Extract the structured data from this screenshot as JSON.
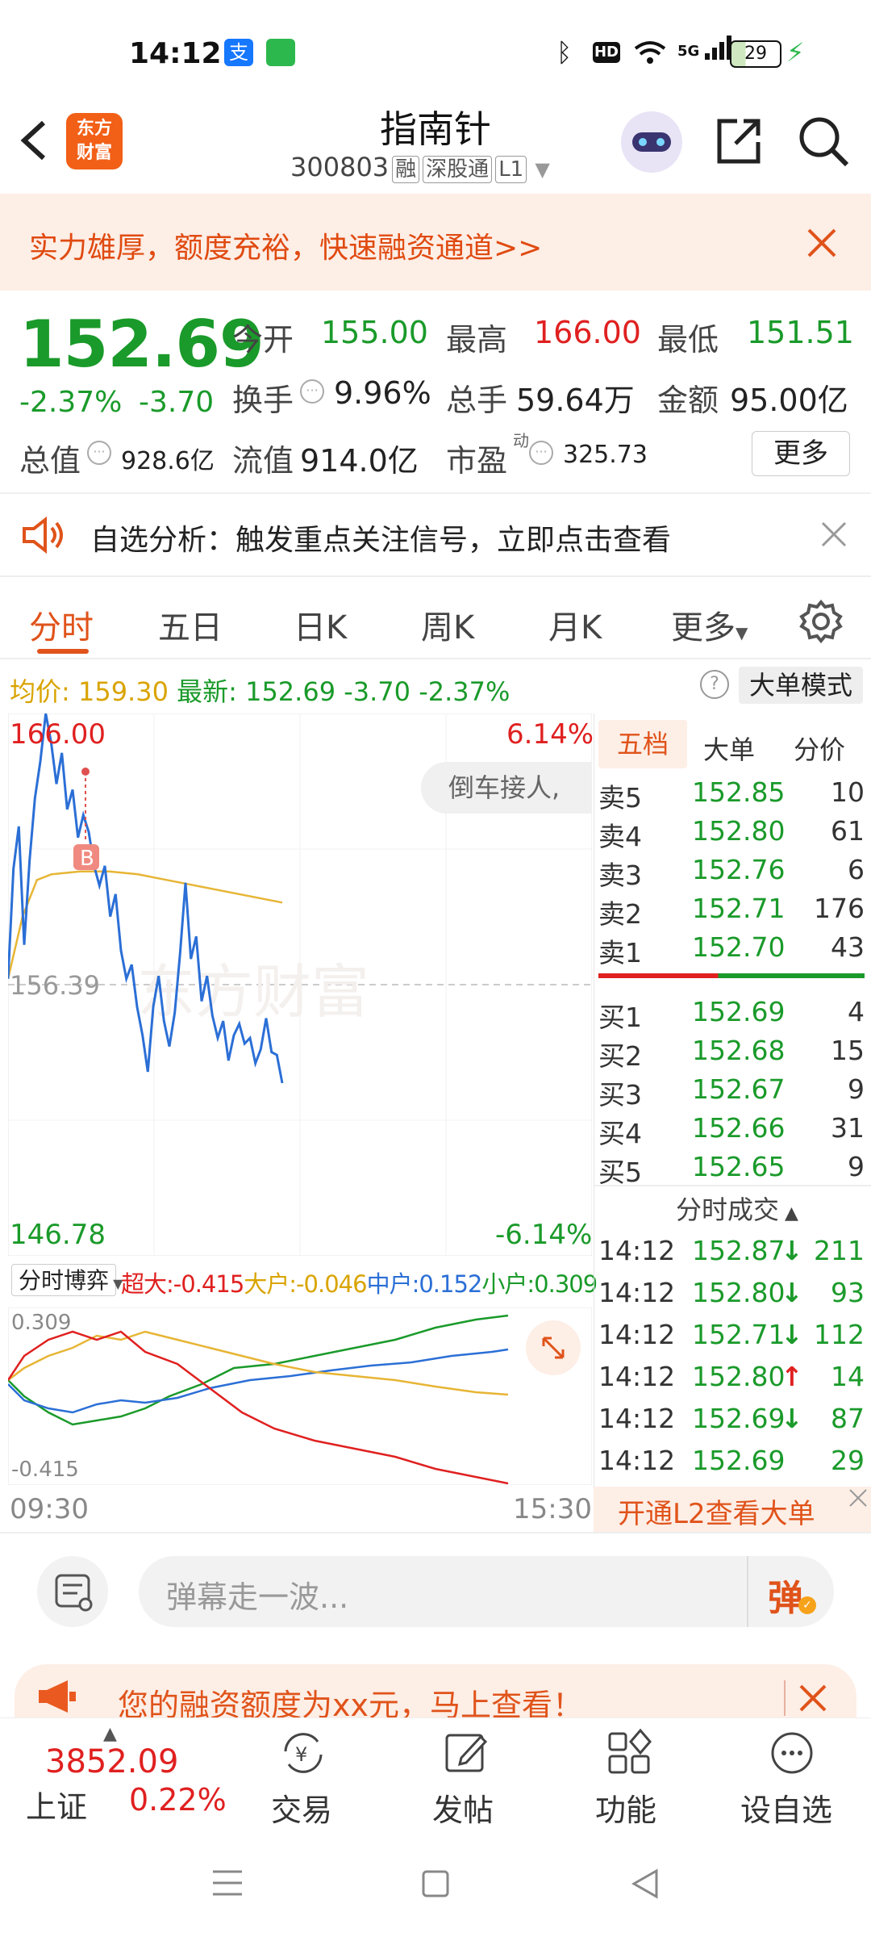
{
  "status": {
    "time": "14:12",
    "battery": "29",
    "network": "5G"
  },
  "header": {
    "back_icon": "chevron-left-icon",
    "logo_text": "东方\n财富",
    "logo_line1": "东方",
    "logo_line2": "财富",
    "name": "指南针",
    "code": "300803",
    "tags": [
      "融",
      "深股通",
      "L1"
    ]
  },
  "banner": {
    "text": "实力雄厚，额度充裕，快速融资通道>>"
  },
  "quote": {
    "price": "152.69",
    "change_pct": "-2.37%",
    "change": "-3.70",
    "open_label": "今开",
    "open": "155.00",
    "high_label": "最高",
    "high": "166.00",
    "low_label": "最低",
    "low": "151.51",
    "turnover_label": "换手",
    "turnover": "9.96%",
    "volume_label": "总手",
    "volume": "59.64万",
    "amount_label": "金额",
    "amount": "95.00亿",
    "mcap_label": "总值",
    "mcap": "928.6亿",
    "float_label": "流值",
    "float": "914.0亿",
    "pe_label": "市盈",
    "pe_sup": "动",
    "pe": "325.73",
    "more_button": "更多"
  },
  "analysis": {
    "text": "自选分析：触发重点关注信号，立即点击查看"
  },
  "tabs": [
    "分时",
    "五日",
    "日K",
    "周K",
    "月K",
    "更多"
  ],
  "avgbar": {
    "avg_label": "均价:",
    "avg": "159.30",
    "latest_label": "最新:",
    "latest": "152.69",
    "change": "-3.70",
    "change_pct": "-2.37%",
    "mode_button": "大单模式"
  },
  "chart": {
    "high": "166.00",
    "high_pct": "6.14%",
    "low": "146.78",
    "low_pct": "-6.14%",
    "mid": "156.39",
    "marker": "B",
    "danmu": "倒车接人,",
    "watermark": "东方财富",
    "time_start": "09:30",
    "time_end": "15:30",
    "colors": {
      "price": "#2b6fd6",
      "avg": "#e7b535",
      "up": "#e02020",
      "down": "#1a9a2a"
    }
  },
  "chart_data": {
    "type": "line",
    "series": [
      {
        "name": "",
        "values": [
          156.6,
          160.5,
          162.0,
          157.8,
          160.8,
          163.0,
          164.3,
          166.0,
          165.0,
          163.5,
          164.6,
          162.6,
          163.3,
          161.6,
          162.4,
          161.8,
          160.6,
          159.9,
          160.6,
          158.8,
          159.6,
          157.6,
          156.6,
          157.1,
          155.6,
          154.6,
          153.3,
          155.6,
          156.7,
          155.1,
          154.2,
          155.4,
          157.5,
          160.0,
          157.3,
          158.1,
          155.8,
          156.7,
          155.3,
          154.5,
          155.1,
          153.7,
          154.6,
          155.0,
          154.3,
          154.5,
          153.6,
          154.1,
          155.2,
          154.0,
          153.9,
          152.9
        ]
      },
      {
        "name": "",
        "values": [
          156.6,
          158.8,
          160.1,
          160.3,
          160.35,
          160.4,
          160.4,
          160.4,
          160.35,
          160.3,
          160.2,
          160.1,
          160.0,
          159.9,
          159.8,
          159.7,
          159.6,
          159.5,
          159.4,
          159.3
        ]
      }
    ],
    "ylim": [
      146.78,
      166.0
    ]
  },
  "subchart": {
    "selector": "分时博弈",
    "super_label": "超大:",
    "super": "-0.415",
    "large_label": "大户:",
    "large": "-0.046",
    "mid_label": "中户:",
    "mid": "0.152",
    "small_label": "小户:",
    "small": "0.309",
    "top": "0.309",
    "bottom": "-0.415"
  },
  "orderbook": {
    "tabs": [
      "五档",
      "大单",
      "分价"
    ],
    "asks": [
      {
        "label": "卖5",
        "price": "152.85",
        "vol": "10"
      },
      {
        "label": "卖4",
        "price": "152.80",
        "vol": "61"
      },
      {
        "label": "卖3",
        "price": "152.76",
        "vol": "6"
      },
      {
        "label": "卖2",
        "price": "152.71",
        "vol": "176"
      },
      {
        "label": "卖1",
        "price": "152.70",
        "vol": "43"
      }
    ],
    "bids": [
      {
        "label": "买1",
        "price": "152.69",
        "vol": "4"
      },
      {
        "label": "买2",
        "price": "152.68",
        "vol": "15"
      },
      {
        "label": "买3",
        "price": "152.67",
        "vol": "9"
      },
      {
        "label": "买4",
        "price": "152.66",
        "vol": "31"
      },
      {
        "label": "买5",
        "price": "152.65",
        "vol": "9"
      }
    ],
    "trades_title": "分时成交",
    "trades": [
      {
        "time": "14:12",
        "price": "152.87",
        "arrow": "↓",
        "vol": "211"
      },
      {
        "time": "14:12",
        "price": "152.80",
        "arrow": "↓",
        "vol": "93"
      },
      {
        "time": "14:12",
        "price": "152.71",
        "arrow": "↓",
        "vol": "112"
      },
      {
        "time": "14:12",
        "price": "152.80",
        "arrow": "↑",
        "vol": "14"
      },
      {
        "time": "14:12",
        "price": "152.69",
        "arrow": "↓",
        "vol": "87"
      },
      {
        "time": "14:12",
        "price": "152.69",
        "arrow": "",
        "vol": "29"
      }
    ],
    "l2_button": "开通L2查看大单"
  },
  "comment": {
    "placeholder": "弹幕走一波...",
    "danmu_button": "弹"
  },
  "promo": {
    "text": "您的融资额度为xx元，马上查看！"
  },
  "bottom_nav": {
    "index_value": "3852.09",
    "index_name": "上证",
    "index_pct": "0.22%",
    "items": [
      "交易",
      "发帖",
      "功能",
      "设自选"
    ]
  }
}
